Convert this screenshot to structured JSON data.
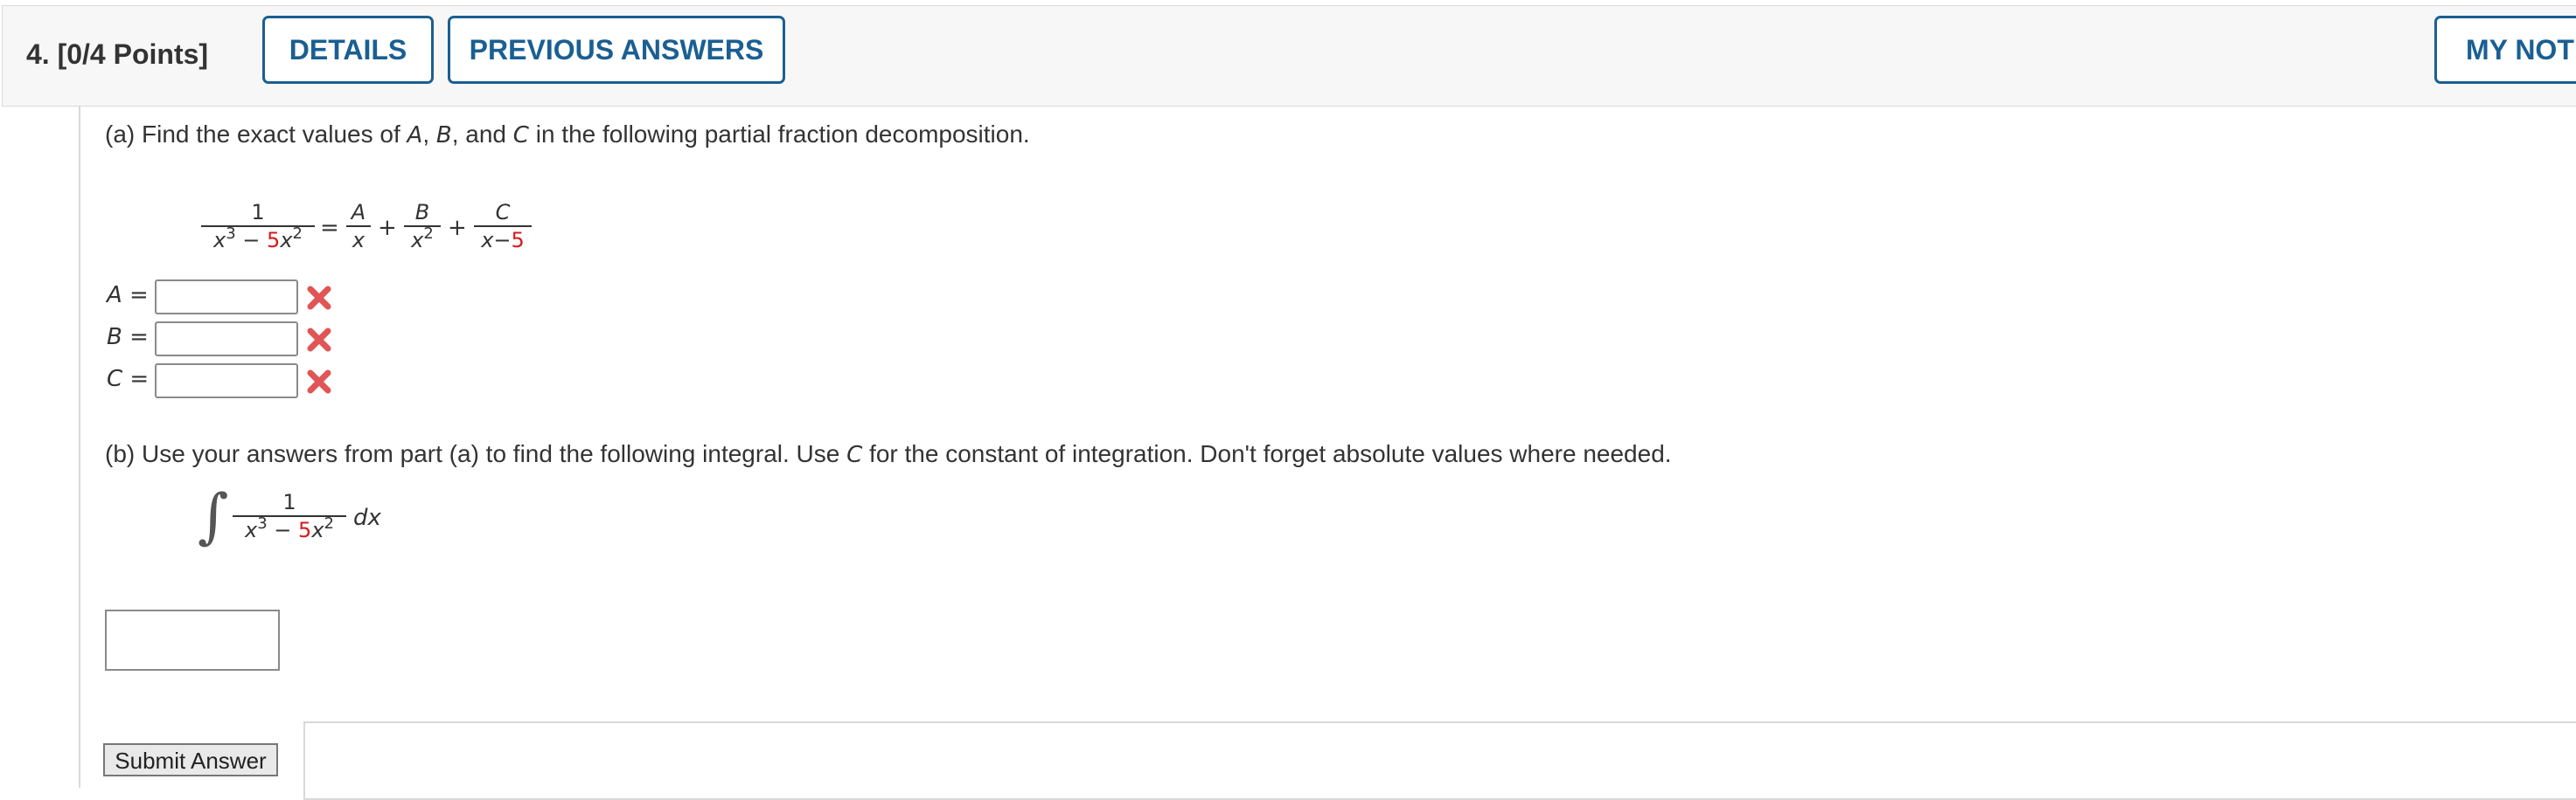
{
  "header": {
    "question_title": "4.  [0/4 Points]",
    "details_label": "DETAILS",
    "previous_answers_label": "PREVIOUS ANSWERS",
    "my_notes_label": "MY NOTES"
  },
  "part_a": {
    "prefix": "(a) Find the exact values of ",
    "var_a": "A",
    "sep1": ", ",
    "var_b": "B",
    "sep2": ", and ",
    "var_c": "C",
    "suffix": " in the following partial fraction decomposition.",
    "lhs_numerator": "1",
    "lhs_den_x": "x",
    "lhs_den_exp1": "3",
    "lhs_den_minus": " − ",
    "lhs_den_coef": "5",
    "lhs_den_x2": "x",
    "lhs_den_exp2": "2",
    "equals": "=",
    "plus1": "+",
    "plus2": "+",
    "t1_num": "A",
    "t1_den": "x",
    "t2_num": "B",
    "t2_den_x": "x",
    "t2_den_exp": "2",
    "t3_num": "C",
    "t3_den_x": "x",
    "t3_den_minus": "−",
    "t3_den_const": "5",
    "answers": [
      {
        "label": "A",
        "eq": " =",
        "value": "",
        "status": "incorrect"
      },
      {
        "label": "B",
        "eq": " =",
        "value": "",
        "status": "incorrect"
      },
      {
        "label": "C",
        "eq": " =",
        "value": "",
        "status": "incorrect"
      }
    ]
  },
  "part_b": {
    "prefix": "(b) Use your answers from part (a) to find the following integral. Use ",
    "var_c": "C",
    "suffix": " for the constant of integration. Don't forget absolute values where needed.",
    "integral_sign": "∫",
    "numerator": "1",
    "den_x": "x",
    "den_exp1": "3",
    "den_minus": " − ",
    "den_coef": "5",
    "den_x2": "x",
    "den_exp2": "2",
    "differential": "dx",
    "answer_value": ""
  },
  "submit_label": "Submit Answer",
  "colors": {
    "accent": "#1a5f92",
    "highlight_red": "#d61b1b",
    "incorrect_mark": "#e05555"
  }
}
